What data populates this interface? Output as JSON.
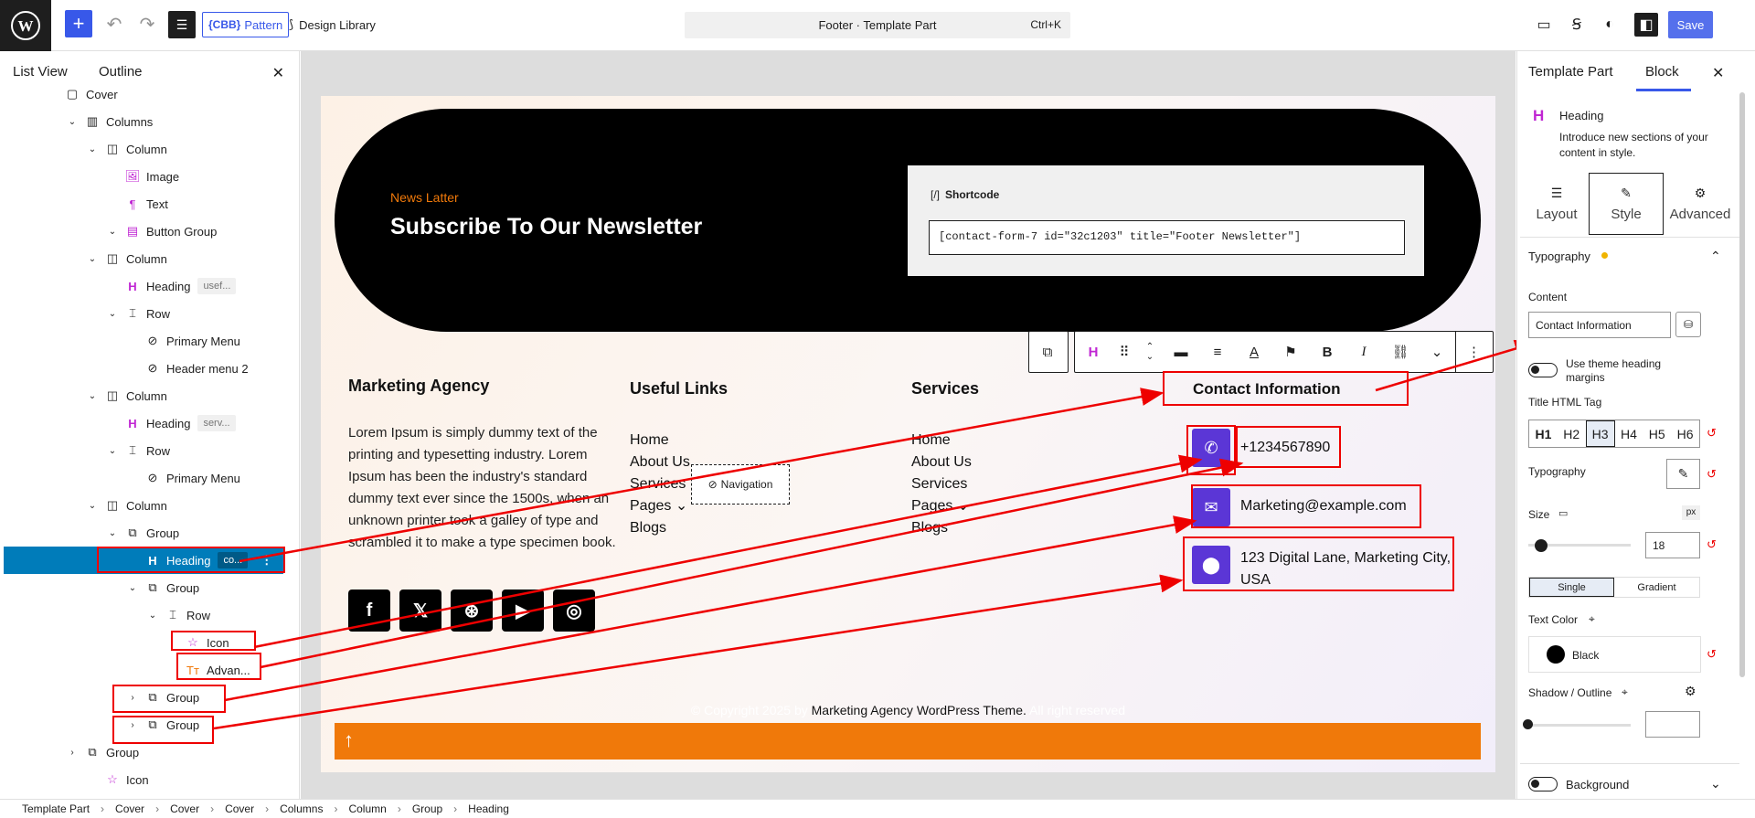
{
  "topbar": {
    "pattern_label": "Pattern",
    "pattern_badge": "{CBB}",
    "design_library": "Design Library",
    "doc_title": "Footer · Template Part",
    "shortcut": "Ctrl+K",
    "save": "Save"
  },
  "left_panel": {
    "tabs": [
      "List View",
      "Outline"
    ],
    "tree": [
      {
        "label": "Cover",
        "indent": 0,
        "icon": "cover-icon"
      },
      {
        "label": "Columns",
        "indent": 1,
        "icon": "columns-icon"
      },
      {
        "label": "Column",
        "indent": 2,
        "icon": "column-icon"
      },
      {
        "label": "Image",
        "indent": 3,
        "icon": "image-icon"
      },
      {
        "label": "Text",
        "indent": 3,
        "icon": "paragraph-icon"
      },
      {
        "label": "Button Group",
        "indent": 3,
        "icon": "button-group-icon"
      },
      {
        "label": "Column",
        "indent": 2,
        "icon": "column-icon"
      },
      {
        "label": "Heading",
        "indent": 3,
        "icon": "heading-icon",
        "tag": "usef..."
      },
      {
        "label": "Row",
        "indent": 3,
        "icon": "row-icon"
      },
      {
        "label": "Primary Menu",
        "indent": 4,
        "icon": "navigation-icon"
      },
      {
        "label": "Header menu 2",
        "indent": 4,
        "icon": "navigation-icon"
      },
      {
        "label": "Column",
        "indent": 2,
        "icon": "column-icon"
      },
      {
        "label": "Heading",
        "indent": 3,
        "icon": "heading-icon",
        "tag": "serv..."
      },
      {
        "label": "Row",
        "indent": 3,
        "icon": "row-icon"
      },
      {
        "label": "Primary Menu",
        "indent": 4,
        "icon": "navigation-icon"
      },
      {
        "label": "Column",
        "indent": 2,
        "icon": "column-icon"
      },
      {
        "label": "Group",
        "indent": 3,
        "icon": "group-icon"
      },
      {
        "label": "Heading",
        "indent": 4,
        "icon": "heading-icon",
        "tag": "co...",
        "selected": true
      },
      {
        "label": "Group",
        "indent": 4,
        "icon": "group-icon"
      },
      {
        "label": "Row",
        "indent": 5,
        "icon": "row-icon"
      },
      {
        "label": "Icon",
        "indent": 6,
        "icon": "star-icon"
      },
      {
        "label": "Advan...",
        "indent": 6,
        "icon": "advanced-text-icon"
      },
      {
        "label": "Group",
        "indent": 4,
        "icon": "group-icon"
      },
      {
        "label": "Group",
        "indent": 4,
        "icon": "group-icon"
      },
      {
        "label": "Group",
        "indent": 1,
        "icon": "group-icon"
      },
      {
        "label": "Icon",
        "indent": 2,
        "icon": "star-icon"
      }
    ]
  },
  "canvas": {
    "news_label": "News Latter",
    "news_title": "Subscribe To Our Newsletter",
    "shortcode_title": "Shortcode",
    "shortcode_value": "[contact-form-7 id=\"32c1203\" title=\"Footer Newsletter\"]",
    "col1_title": "Marketing Agency",
    "col1_body": "Lorem Ipsum is simply dummy text of the printing and typesetting industry. Lorem Ipsum has been the industry's standard dummy text ever since the 1500s, when an unknown printer took a galley of type and scrambled it to make a type specimen book.",
    "col2_title": "Useful Links",
    "col2_links": [
      "Home",
      "About Us",
      "Services",
      "Pages ⌄",
      "Blogs"
    ],
    "col3_title": "Services",
    "col3_links": [
      "Home",
      "About Us",
      "Services",
      "Pages ⌄",
      "Blogs"
    ],
    "col4_title": "Contact Information",
    "phone": "+1234567890",
    "email": "Marketing@example.com",
    "address": "123 Digital Lane, Marketing City, USA",
    "nav_tooltip": "Navigation",
    "copyright_pre": "© Copyright 2025 by ",
    "copyright_link": "Marketing Agency WordPress Theme.",
    "copyright_post": " All right reserved"
  },
  "right_panel": {
    "tabs": [
      "Template Part",
      "Block"
    ],
    "block_name": "Heading",
    "block_desc": "Introduce new sections of your content in style.",
    "subtabs": [
      "Layout",
      "Style",
      "Advanced"
    ],
    "typography_section": "Typography",
    "content_label": "Content",
    "content_value": "Contact Information",
    "theme_margins": "Use theme heading margins",
    "title_tag_label": "Title HTML Tag",
    "tags": [
      "H1",
      "H2",
      "H3",
      "H4",
      "H5",
      "H6"
    ],
    "typography_label": "Typography",
    "size_label": "Size",
    "size_unit": "px",
    "size_value": "18",
    "color_modes": [
      "Single",
      "Gradient"
    ],
    "text_color_label": "Text Color",
    "text_color_value": "Black",
    "shadow_label": "Shadow / Outline",
    "background_label": "Background"
  },
  "breadcrumb": [
    "Template Part",
    "Cover",
    "Cover",
    "Cover",
    "Columns",
    "Column",
    "Group",
    "Heading"
  ],
  "colors": {
    "accent": "#3858e9",
    "orange": "#f0790a",
    "purple": "#5b36d6",
    "selection": "#007cba",
    "annotation": "#e00000"
  }
}
